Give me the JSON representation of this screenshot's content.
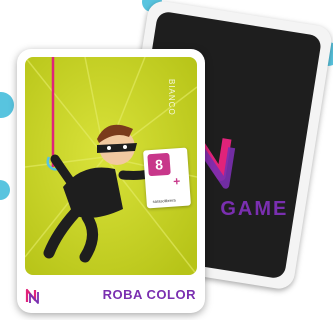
{
  "colors": {
    "accent_purple": "#7a2fb0",
    "accent_pink": "#e0237a",
    "art_yellow_green": "#c6d21e",
    "bubble_blue": "#58c4df",
    "card_back_dark": "#1e1e1e"
  },
  "front_card": {
    "label": "ROBA COLOR",
    "side_text": "BIANCO",
    "mini_card_number": "8",
    "mini_card_small_text": "sarasolibrera",
    "logo_icon": "n-logo-icon"
  },
  "back_card": {
    "logo_text": "GAME",
    "logo_icon": "n-logo-icon"
  },
  "illustration": {
    "subject": "masked-thief-icon"
  }
}
